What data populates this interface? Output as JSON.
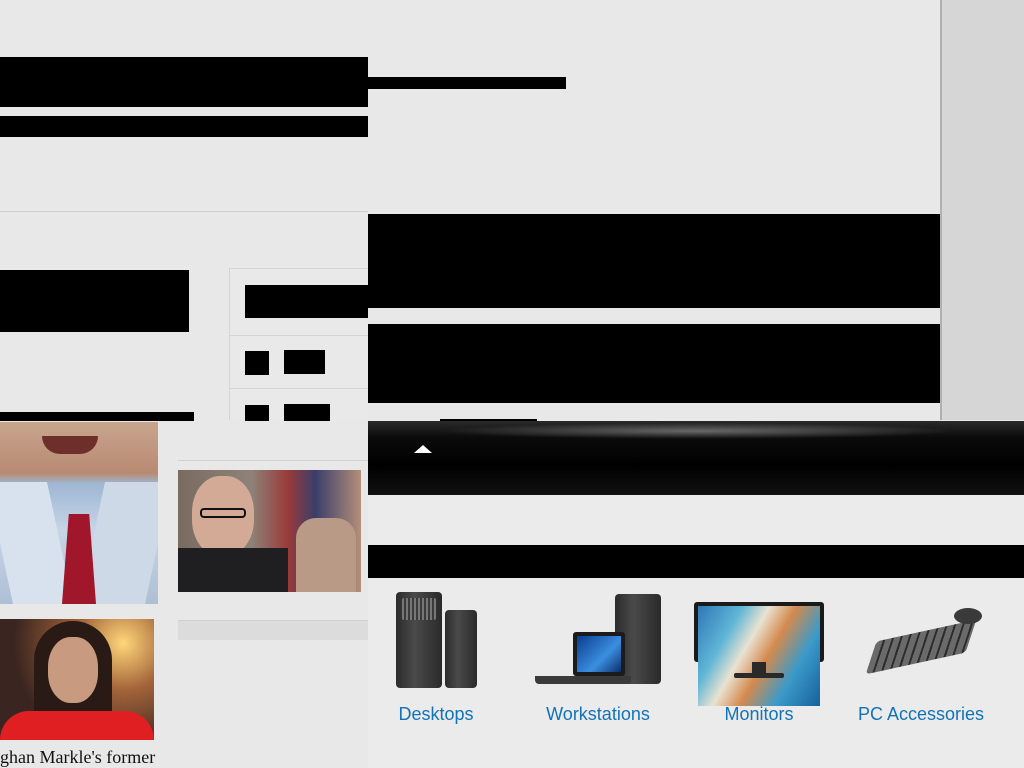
{
  "news": {
    "caption_partial": "ghan Markle's former"
  },
  "dell": {
    "products": [
      {
        "label": "Desktops",
        "icon": "desktop-tower-icon"
      },
      {
        "label": "Workstations",
        "icon": "workstation-icon"
      },
      {
        "label": "Monitors",
        "icon": "monitor-icon"
      },
      {
        "label": "PC Accessories",
        "icon": "keyboard-mouse-icon"
      }
    ],
    "link_color": "#1273b8",
    "collapse_icon": "chevron-up-icon"
  },
  "colors": {
    "page_background": "#e8e8e8",
    "redaction": "#000000",
    "scroll_gutter": "#d6d6d6"
  }
}
